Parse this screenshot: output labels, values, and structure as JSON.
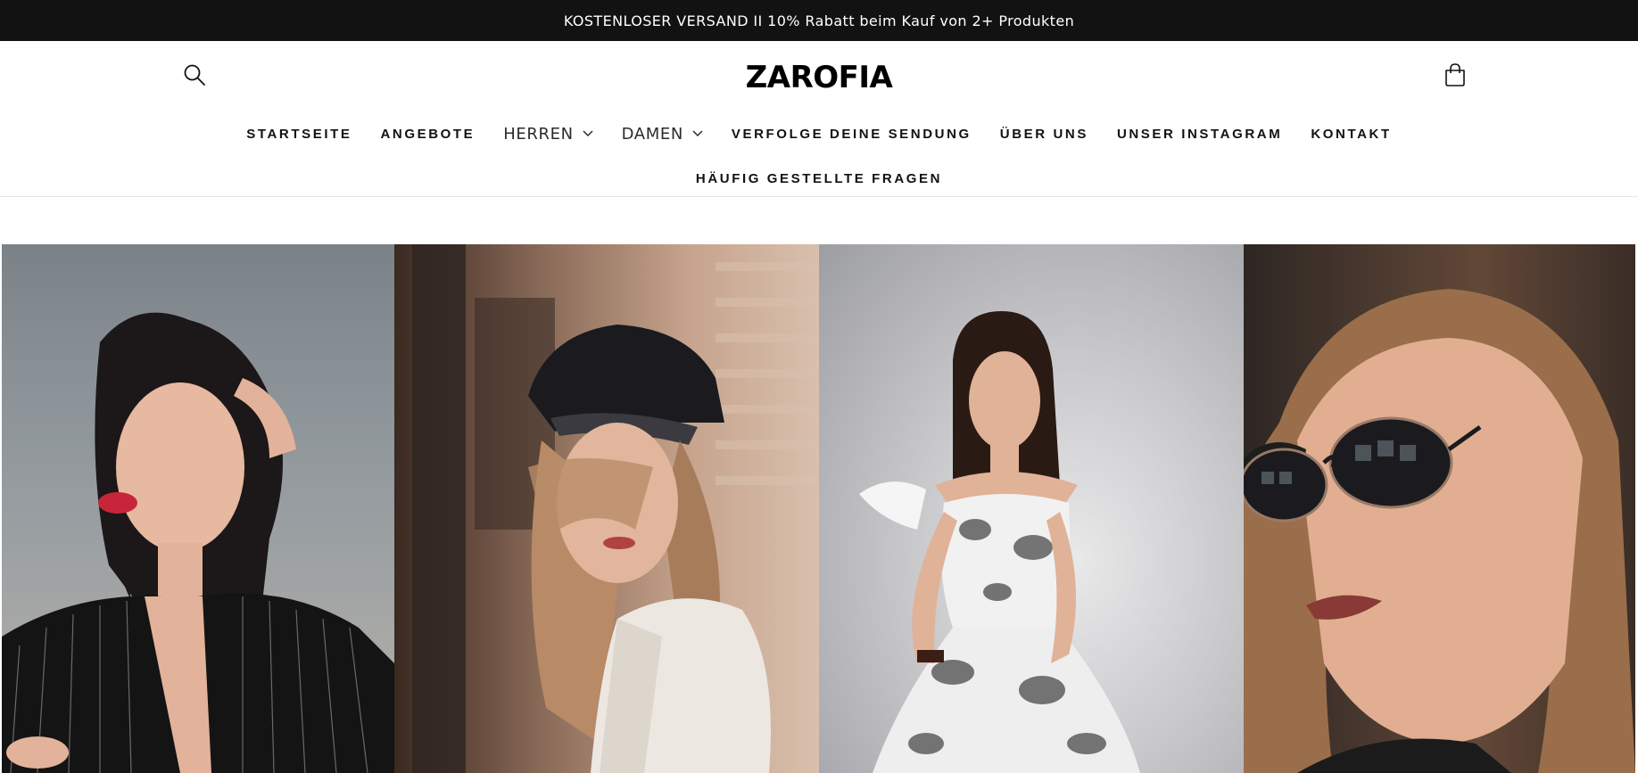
{
  "announcement": {
    "text": "KOSTENLOSER VERSAND II 10% Rabatt beim Kauf von 2+ Produkten"
  },
  "header": {
    "logo": "ZAROFIA",
    "search_icon": "search-icon",
    "cart_icon": "cart-icon"
  },
  "nav": {
    "row1": [
      {
        "label": "STARTSEITE"
      },
      {
        "label": "ANGEBOTE"
      },
      {
        "label": "HERREN",
        "dropdown": true
      },
      {
        "label": "DAMEN",
        "dropdown": true
      },
      {
        "label": "VERFOLGE DEINE SENDUNG"
      },
      {
        "label": "ÜBER UNS"
      },
      {
        "label": "UNSER INSTAGRAM"
      },
      {
        "label": "KONTAKT"
      }
    ],
    "row2": [
      {
        "label": "HÄUFIG GESTELLTE FRAGEN"
      }
    ]
  },
  "colors": {
    "announcement_bg": "#121212",
    "text": "#121212",
    "background": "#ffffff"
  }
}
